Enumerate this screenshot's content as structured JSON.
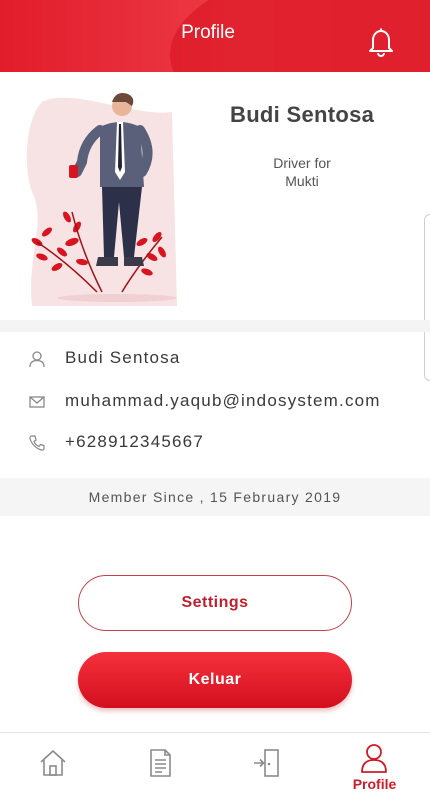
{
  "header": {
    "title": "Profile",
    "bell_icon": "bell-icon"
  },
  "profile": {
    "name": "Budi Sentosa",
    "role": "Driver for Mukti"
  },
  "info": {
    "name": "Budi Sentosa",
    "email": "muhammad.yaqub@indosystem.com",
    "phone": "+628912345667"
  },
  "member_since": "Member Since , 15 February 2019",
  "buttons": {
    "settings": "Settings",
    "logout": "Keluar"
  },
  "tabs": [
    {
      "icon": "home-icon",
      "label": ""
    },
    {
      "icon": "document-icon",
      "label": ""
    },
    {
      "icon": "door-enter-icon",
      "label": ""
    },
    {
      "icon": "user-icon",
      "label": "Profile",
      "active": true
    }
  ],
  "colors": {
    "primary": "#e21c2b",
    "primary_dark": "#d30f1e",
    "text": "#3a3a3a"
  }
}
